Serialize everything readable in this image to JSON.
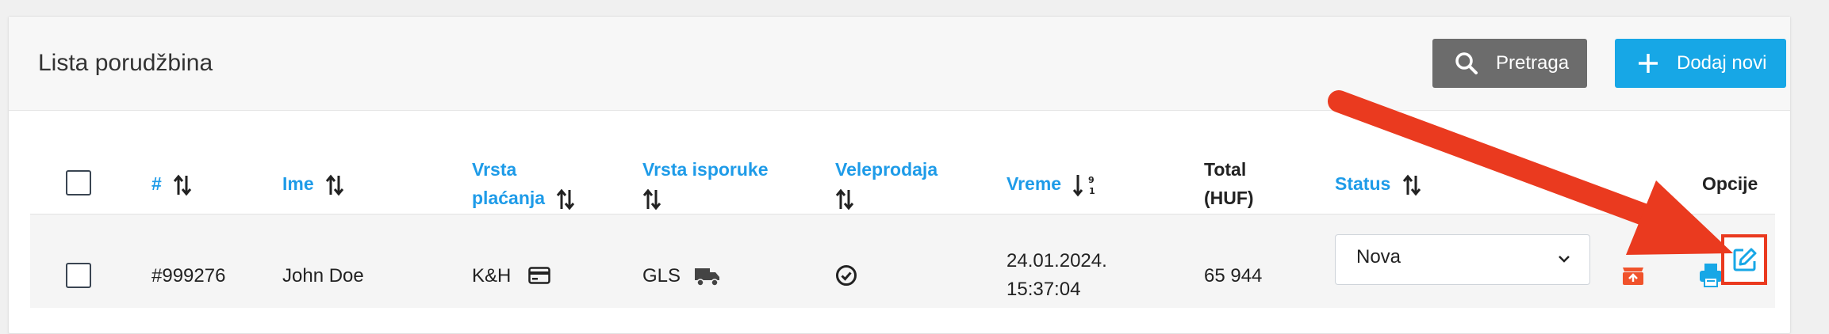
{
  "header": {
    "title": "Lista porudžbina",
    "search_label": "Pretraga",
    "add_label": "Dodaj novi"
  },
  "columns": {
    "id": "#",
    "name": "Ime",
    "payment_line1": "Vrsta",
    "payment_line2": "plaćanja",
    "delivery": "Vrsta isporuke",
    "wholesale": "Veleprodaja",
    "time": "Vreme",
    "total_line1": "Total",
    "total_line2": "(HUF)",
    "status": "Status",
    "options": "Opcije"
  },
  "rows": [
    {
      "id": "#999276",
      "name": "John Doe",
      "payment": "K&H",
      "delivery": "GLS",
      "date": "24.01.2024.",
      "time": "15:37:04",
      "total": "65 944",
      "status": "Nova"
    }
  ],
  "colors": {
    "accent": "#17a7e6",
    "link": "#1e9be8",
    "search_button": "#6c6c6c",
    "annotation_arrow": "#ea3a1f",
    "archive_icon": "#f0522b",
    "print_icon": "#17a7e6"
  },
  "icons": {
    "search": "search-icon",
    "add": "plus-icon",
    "sort": "sort-arrows-icon",
    "sort_desc": "sort-numeric-desc-icon",
    "card": "credit-card-icon",
    "truck": "truck-icon",
    "check": "check-circle-icon",
    "chevron": "chevron-down-icon",
    "archive": "archive-icon",
    "print": "printer-icon",
    "edit": "edit-icon"
  }
}
